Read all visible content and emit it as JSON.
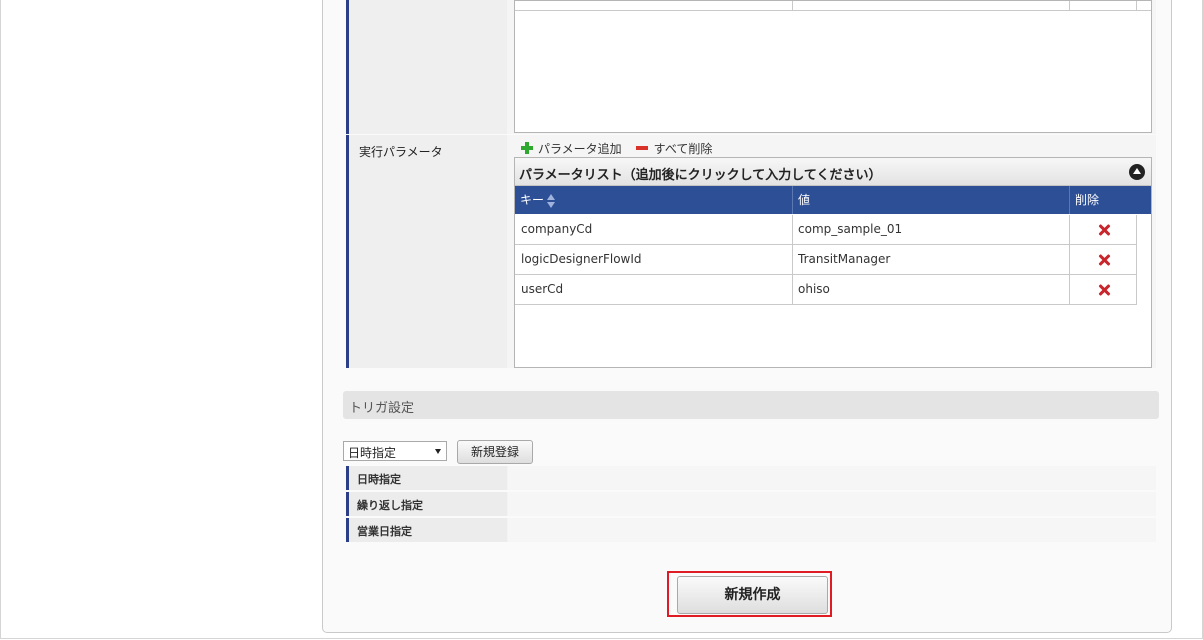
{
  "params_section": {
    "label": "実行パラメータ",
    "add_label": "パラメータ追加",
    "delete_all_label": "すべて削除",
    "grid_title": "パラメータリスト（追加後にクリックして入力してください）",
    "columns": [
      "キー",
      "値",
      "削除"
    ],
    "rows": [
      {
        "key": "companyCd",
        "value": "comp_sample_01"
      },
      {
        "key": "logicDesignerFlowId",
        "value": "TransitManager"
      },
      {
        "key": "userCd",
        "value": "ohiso"
      }
    ]
  },
  "trigger_section": {
    "header": "トリガ設定",
    "select_value": "日時指定",
    "register_label": "新規登録",
    "rows": [
      "日時指定",
      "繰り返し指定",
      "営業日指定"
    ]
  },
  "actions": {
    "create_label": "新規作成"
  },
  "colors": {
    "grid_header": "#2d4f96",
    "label_accent": "#2a3f86",
    "highlight": "#e01b24",
    "delete": "#c8262b",
    "add": "#2ea82e"
  }
}
